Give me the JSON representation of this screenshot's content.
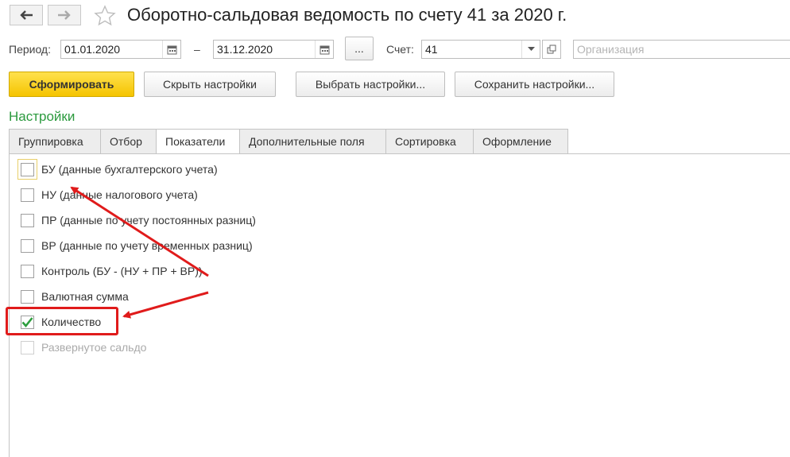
{
  "window": {
    "title": "Оборотно-сальдовая ведомость по счету 41 за 2020 г."
  },
  "filters": {
    "period_label": "Период:",
    "date_from": "01.01.2020",
    "dash": "–",
    "date_to": "31.12.2020",
    "more_label": "...",
    "account_label": "Счет:",
    "account_value": "41",
    "organization_placeholder": "Организация"
  },
  "toolbar": {
    "generate": "Сформировать",
    "hide_settings": "Скрыть настройки",
    "choose_settings": "Выбрать настройки...",
    "save_settings": "Сохранить настройки..."
  },
  "settings": {
    "title": "Настройки",
    "tabs": [
      "Группировка",
      "Отбор",
      "Показатели",
      "Дополнительные поля",
      "Сортировка",
      "Оформление"
    ],
    "active_tab": "Показатели",
    "indicators": [
      {
        "label": "БУ (данные бухгалтерского учета)",
        "checked": false,
        "enabled": true
      },
      {
        "label": "НУ (данные налогового учета)",
        "checked": false,
        "enabled": true
      },
      {
        "label": "ПР (данные по учету постоянных разниц)",
        "checked": false,
        "enabled": true
      },
      {
        "label": "ВР (данные по учету временных разниц)",
        "checked": false,
        "enabled": true
      },
      {
        "label": "Контроль (БУ - (НУ + ПР + ВР))",
        "checked": false,
        "enabled": true
      },
      {
        "label": "Валютная сумма",
        "checked": false,
        "enabled": true
      },
      {
        "label": "Количество",
        "checked": true,
        "enabled": true
      },
      {
        "label": "Развернутое сальдо",
        "checked": false,
        "enabled": false
      }
    ]
  },
  "colors": {
    "accent": "#f5c400",
    "section_title": "#2b9a3e",
    "annotation": "#e01b1b",
    "check": "#2e9e3e"
  },
  "icons": [
    "back-arrow-icon",
    "forward-arrow-icon",
    "star-icon",
    "calendar-icon",
    "dropdown-arrow-icon",
    "open-link-icon",
    "checkmark-icon"
  ]
}
